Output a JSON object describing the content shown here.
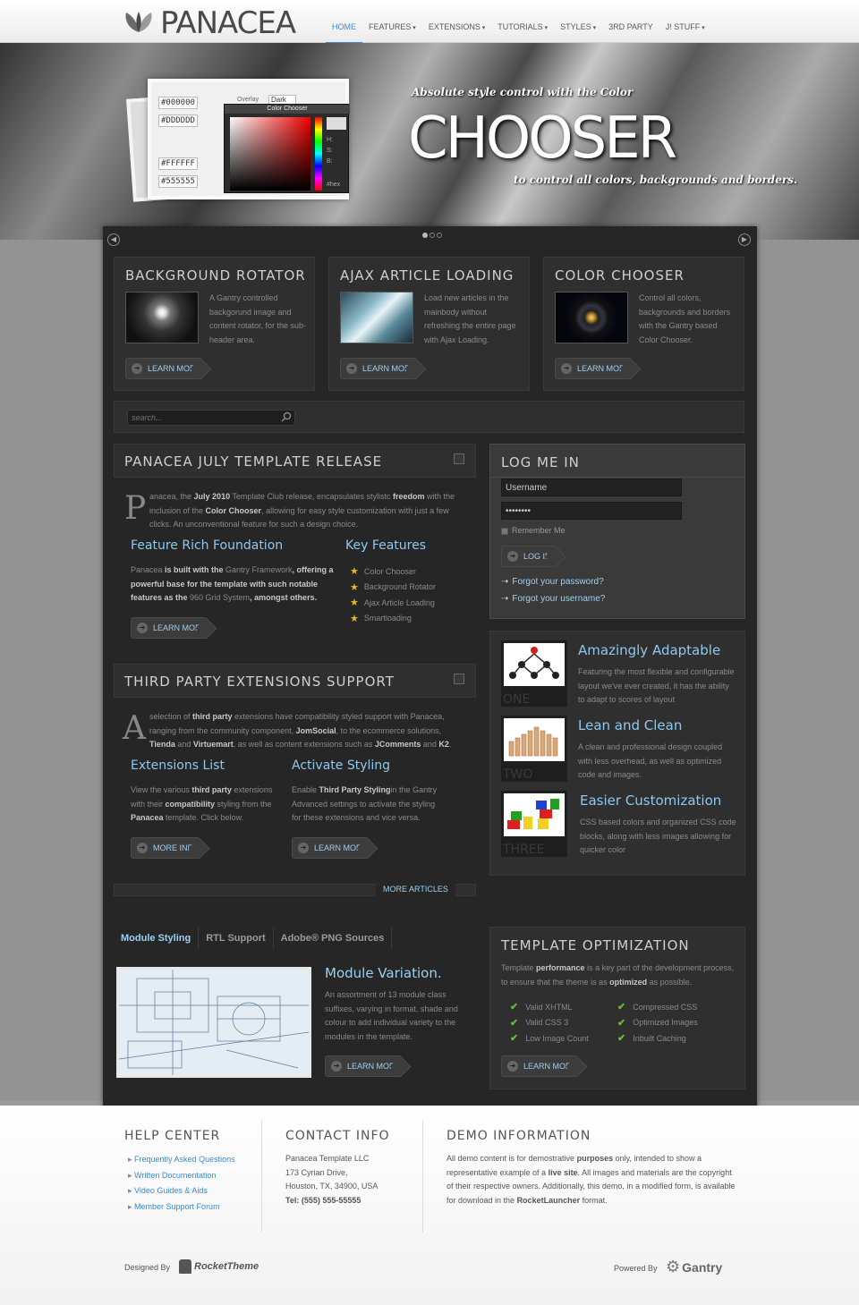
{
  "header": {
    "logo": "PANACEA",
    "nav": [
      "HOME",
      "FEATURES",
      "EXTENSIONS",
      "TUTORIALS",
      "STYLES",
      "3RD PARTY",
      "J! STUFF"
    ],
    "nav_dropdowns": [
      false,
      true,
      true,
      true,
      true,
      false,
      true
    ]
  },
  "hero": {
    "tagline_top": "Absolute style control with the Color",
    "title": "CHOOSER",
    "tagline_bottom": "to control all colors, backgrounds and borders.",
    "chooser": {
      "title": "Color Chooser",
      "swatches": [
        "#000000",
        "#DDDDDD",
        "#FFFFFF",
        "#555555"
      ],
      "overlay_label": "Overlay",
      "overlay_value": "Dark",
      "hsb": [
        "H:",
        "S:",
        "B:"
      ],
      "hex_label": "#hex"
    }
  },
  "features": [
    {
      "title": "BACKGROUND ROTATOR",
      "text": "A Gantry controlled backgorund image and content rotator, for the sub-header area.",
      "button": "LEARN MORE"
    },
    {
      "title": "AJAX ARTICLE LOADING",
      "text": "Load new articles in the mainbody without refreshing the entire page with Ajax Loading.",
      "button": "LEARN MORE"
    },
    {
      "title": "COLOR CHOOSER",
      "text": "Control all colors, backgrounds and borders with the Gantry based Color Chooser.",
      "button": "LEARN MORE"
    }
  ],
  "search": {
    "placeholder": "search..."
  },
  "release": {
    "title": "PANACEA JULY TEMPLATE RELEASE",
    "dropcap": "P",
    "intro_parts": [
      "anacea, the ",
      "July 2010",
      " Template Club release, encapsulates stylistc ",
      "freedom",
      " with the inclusion of the ",
      "Color Chooser",
      ", allowing for easy style customization with just a few clicks. An unconventional feature for such a design choice."
    ],
    "col1_title": "Feature Rich Foundation",
    "col1_parts": [
      "Panacea",
      " is built with the ",
      "Gantry Framework",
      ", offering a powerful base for the template with such notable features as the ",
      "960 Grid System",
      ", amongst others."
    ],
    "col1_button": "LEARN MORE",
    "col2_title": "Key Features",
    "key_features": [
      "Color Chooser",
      "Background Rotator",
      "Ajax Article Loading",
      "Smartloading"
    ]
  },
  "thirdparty": {
    "title": "THIRD PARTY EXTENSIONS SUPPORT",
    "dropcap": "A",
    "intro_parts": [
      "selection of ",
      "third party",
      " extensions have compatibility styled support with Panacea, ranging from the community component, ",
      "JomSocial",
      ", to the ecommerce solutions, ",
      "Tienda",
      " and ",
      "Virtuemart",
      ", as well as content extensions such as ",
      "JComments",
      " and ",
      "K2",
      "."
    ],
    "col1_title": "Extensions List",
    "col1_parts": [
      "View the various ",
      "third party",
      " extensions with their ",
      "compatibility",
      " styling from the ",
      "Panacea",
      " template. Click below."
    ],
    "col1_button": "MORE INFO",
    "col2_title": "Activate Styling",
    "col2_parts": [
      "Enable ",
      "Third Party Styling",
      "in the Gantry Advanced settings to activate the styling for these extensions and vice versa."
    ],
    "col2_button": "LEARN MORE"
  },
  "more_articles": "MORE ARTICLES",
  "login": {
    "title": "LOG ME IN",
    "username": "Username",
    "password": "••••••••",
    "remember": "Remember Me",
    "button": "LOG IN",
    "forgot_password": "Forgot your password?",
    "forgot_username": "Forgot your username?"
  },
  "showcase": [
    {
      "title": "Amazingly Adaptable",
      "text": "Featuring the most flexible and configurable layout we've ever created, it has the ability to adapt to scores of layout",
      "label": "ONE"
    },
    {
      "title": "Lean and Clean",
      "text": "A clean and professional design coupled with less overhead, as well as optimized code and images.",
      "label": "TWO"
    },
    {
      "title": "Easier Customization",
      "text": "CSS based colors and organized CSS code blocks, along with less images allowing for quicker color",
      "label": "THREE"
    }
  ],
  "tabs": {
    "items": [
      "Module Styling",
      "RTL Support",
      "Adobe® PNG Sources"
    ],
    "active": 0,
    "content_title": "Module Variation.",
    "content_text": "An assortment of 13 module class suffixes, varying in format, shade and colour to add individual variety to the modules in the template.",
    "button": "LEARN MORE"
  },
  "optimization": {
    "title": "TEMPLATE OPTIMIZATION",
    "text_parts": [
      "Template ",
      "performance",
      " is a key part of the development process, to ensure that the theme is as ",
      "optimized",
      " as possible."
    ],
    "col1": [
      "Valid XHTML",
      "Valid CSS 3",
      "Low Image Count"
    ],
    "col2": [
      "Compressed CSS",
      "Optimized Images",
      "Inbuilt Caching"
    ],
    "button": "LEARN MORE"
  },
  "footer": {
    "help_title": "HELP CENTER",
    "help_links": [
      "Frequently Asked Questions",
      "Written Documentation",
      "Video Guides & Aids",
      "Member Support Forum"
    ],
    "contact_title": "CONTACT INFO",
    "contact_lines": [
      "Panacea Template LLC",
      "173 Cyrian Drive,",
      "Houston, TX, 34900, USA",
      "Tel: (555) 555-55555"
    ],
    "demo_title": "DEMO INFORMATION",
    "demo_parts": [
      "All demo content is for demostrative ",
      "purposes",
      " only, intended to show a representative example of a ",
      "live site",
      ". All images and materials are the copyright of their respective owners. Additionally, this demo, in a modified form, is available for download in the ",
      "RocketLauncher",
      " format."
    ],
    "designed_by": "Designed By",
    "designer": "RocketTheme",
    "powered_by": "Powered By",
    "powered": "Gantry"
  },
  "colors": {
    "accent": "#3a8ad0",
    "link_light": "#9dd0f0",
    "heading_blue": "#8ec8ee",
    "star": "#e8b820",
    "check": "#5fbf3a"
  }
}
